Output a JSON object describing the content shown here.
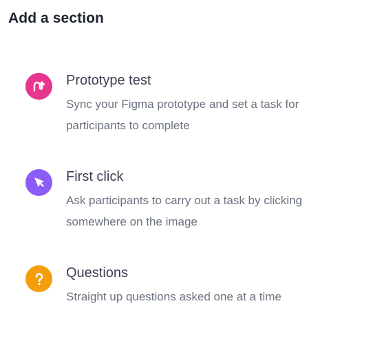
{
  "header": {
    "title": "Add a section"
  },
  "options": [
    {
      "title": "Prototype test",
      "description": "Sync your Figma prototype and set a task for participants to complete",
      "icon": "prototype-icon",
      "color": "#e8368f"
    },
    {
      "title": "First click",
      "description": "Ask participants to carry out a task by clicking somewhere on the image",
      "icon": "cursor-icon",
      "color": "#8b5cf6"
    },
    {
      "title": "Questions",
      "description": "Straight up questions asked one at a time",
      "icon": "question-mark-icon",
      "color": "#f59e0b"
    }
  ]
}
